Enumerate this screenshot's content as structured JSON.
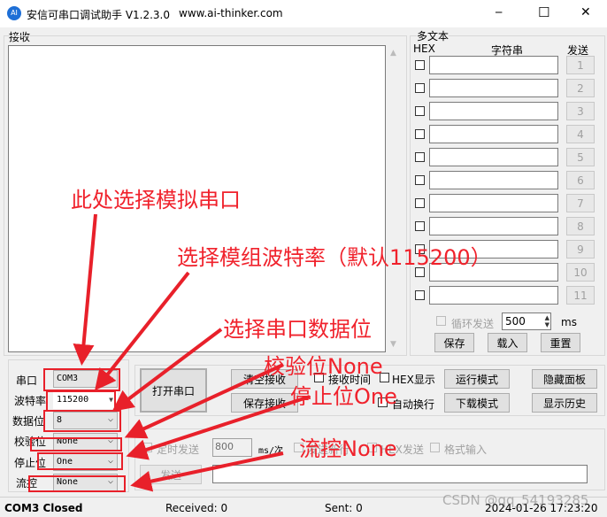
{
  "window": {
    "title": "安信可串口调试助手 V1.2.3.0",
    "url": "www.ai-thinker.com",
    "logo": "AI",
    "minimize": "─",
    "maximize": "☐",
    "close": "✕"
  },
  "receive": {
    "label": "接收",
    "content": ""
  },
  "multi": {
    "group": "多文本",
    "hex": "HEX",
    "string": "字符串",
    "send": "发送",
    "rows": [
      "1",
      "2",
      "3",
      "4",
      "5",
      "6",
      "7",
      "8",
      "9",
      "10",
      "11"
    ],
    "loop_label": "循环发送",
    "loop_ms": "500",
    "ms": "ms",
    "save": "保存",
    "load": "载入",
    "reset": "重置"
  },
  "serial": {
    "port_label": "串口",
    "port": "COM3",
    "baud_label": "波特率",
    "baud": "115200",
    "data_label": "数据位",
    "data": "8",
    "parity_label": "校验位",
    "parity": "None",
    "stop_label": "停止位",
    "stop": "One",
    "flow_label": "流控",
    "flow": "None"
  },
  "controls": {
    "open": "打开串口",
    "clear": "清空接收",
    "save_recv": "保存接收",
    "recv_time": "接收时间",
    "hex_show": "HEX显示",
    "auto_wrap": "自动换行",
    "run_mode": "运行模式",
    "dl_mode": "下载模式",
    "hide_panel": "隐藏面板",
    "show_history": "显示历史"
  },
  "send": {
    "timed": "定时发送",
    "interval": "800",
    "unit": "ms/次",
    "newline": "发送新行",
    "hex_send": "HEX发送",
    "format": "格式输入",
    "send": "发送",
    "input": ""
  },
  "status": {
    "port": "COM3 Closed",
    "received": "Received: 0",
    "sent": "Sent: 0",
    "time": "2024-01-26 17:23:20"
  },
  "watermark": "CSDN @qq_54193285",
  "annotations": {
    "a1": "此处选择模拟串口",
    "a2": "选择模组波特率（默认115200）",
    "a3": "选择串口数据位",
    "a4": "校验位None",
    "a5": "停止位One",
    "a6": "流控None"
  },
  "colors": {
    "annotation": "#e8202a",
    "logo": "#1e6fd6"
  }
}
